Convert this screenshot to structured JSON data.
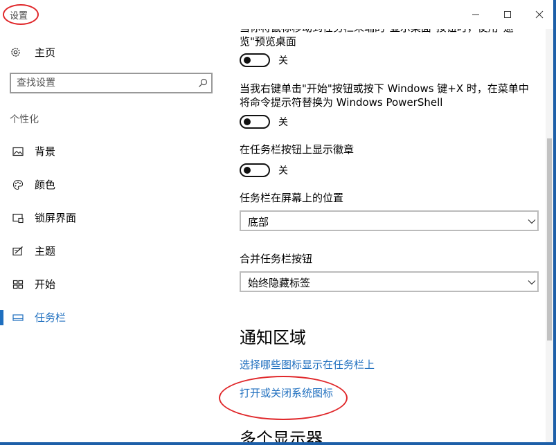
{
  "window": {
    "title": "设置"
  },
  "sidebar": {
    "home_label": "主页",
    "search_placeholder": "查找设置",
    "section_label": "个性化",
    "items": [
      {
        "label": "背景",
        "icon": "image-icon"
      },
      {
        "label": "颜色",
        "icon": "palette-icon"
      },
      {
        "label": "锁屏界面",
        "icon": "lock-screen-icon"
      },
      {
        "label": "主题",
        "icon": "theme-icon"
      },
      {
        "label": "开始",
        "icon": "start-grid-icon"
      },
      {
        "label": "任务栏",
        "icon": "taskbar-icon",
        "active": true
      }
    ]
  },
  "content": {
    "peek_text": "当你将鼠标移动到任务栏末端的\"显示桌面\"按钮时，使用\"速览\"预览桌面",
    "peek_state": "关",
    "powershell_text": "当我右键单击\"开始\"按钮或按下 Windows 键+X 时，在菜单中将命令提示符替换为 Windows PowerShell",
    "powershell_state": "关",
    "badge_text": "在任务栏按钮上显示徽章",
    "badge_state": "关",
    "position_label": "任务栏在屏幕上的位置",
    "position_value": "底部",
    "combine_label": "合并任务栏按钮",
    "combine_value": "始终隐藏标签",
    "notification_heading": "通知区域",
    "link_select_icons": "选择哪些图标显示在任务栏上",
    "link_system_icons": "打开或关闭系统图标",
    "multi_display_heading": "多个显示器"
  },
  "colors": {
    "accent": "#1f6fbf",
    "annotation": "#e0272a",
    "frame": "#1d5fa8"
  }
}
